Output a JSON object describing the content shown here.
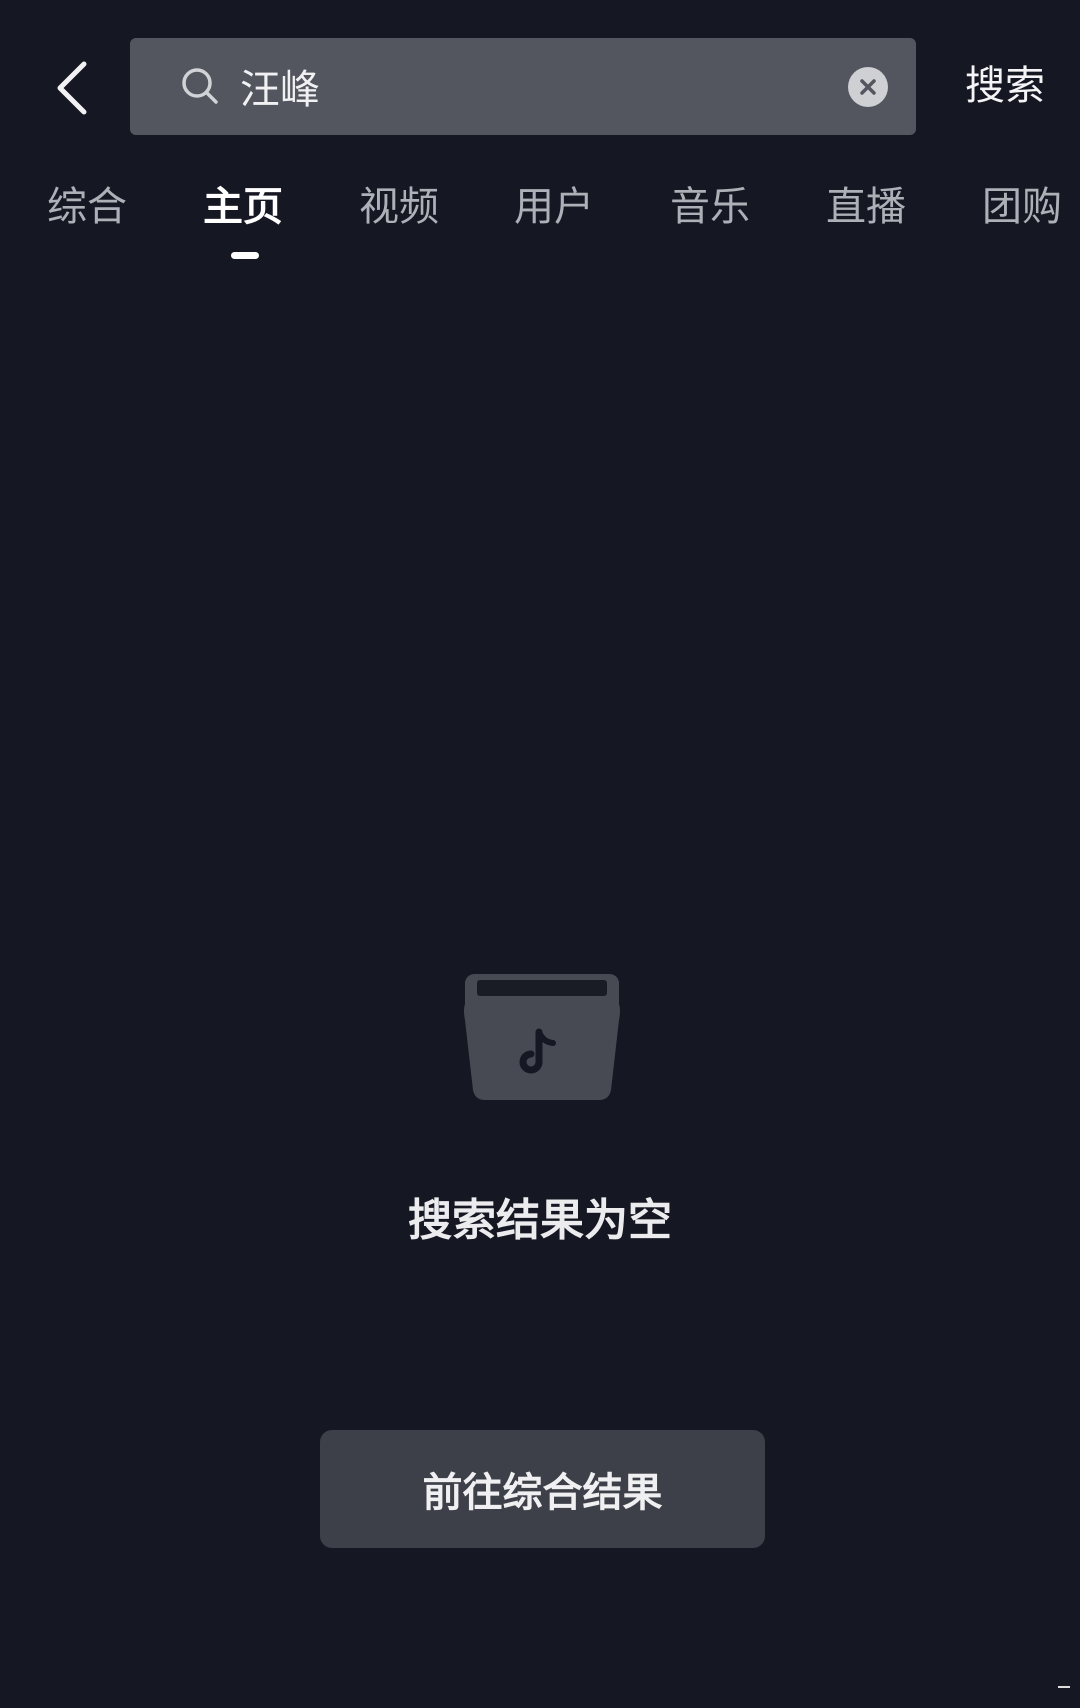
{
  "header": {
    "back_icon": "chevron-left-icon",
    "search_query": "汪峰",
    "search_placeholder": "",
    "search_button": "搜索"
  },
  "tabs": [
    {
      "label": "综合",
      "active": false
    },
    {
      "label": "主页",
      "active": true
    },
    {
      "label": "视频",
      "active": false
    },
    {
      "label": "用户",
      "active": false
    },
    {
      "label": "音乐",
      "active": false
    },
    {
      "label": "直播",
      "active": false
    },
    {
      "label": "团购",
      "active": false
    }
  ],
  "empty_state": {
    "icon": "empty-box-icon",
    "message": "搜索结果为空",
    "action_label": "前往综合结果"
  },
  "colors": {
    "background": "#151722",
    "search_box": "#53565f",
    "button": "#3e4049",
    "inactive_tab": "#aeb0b7"
  }
}
